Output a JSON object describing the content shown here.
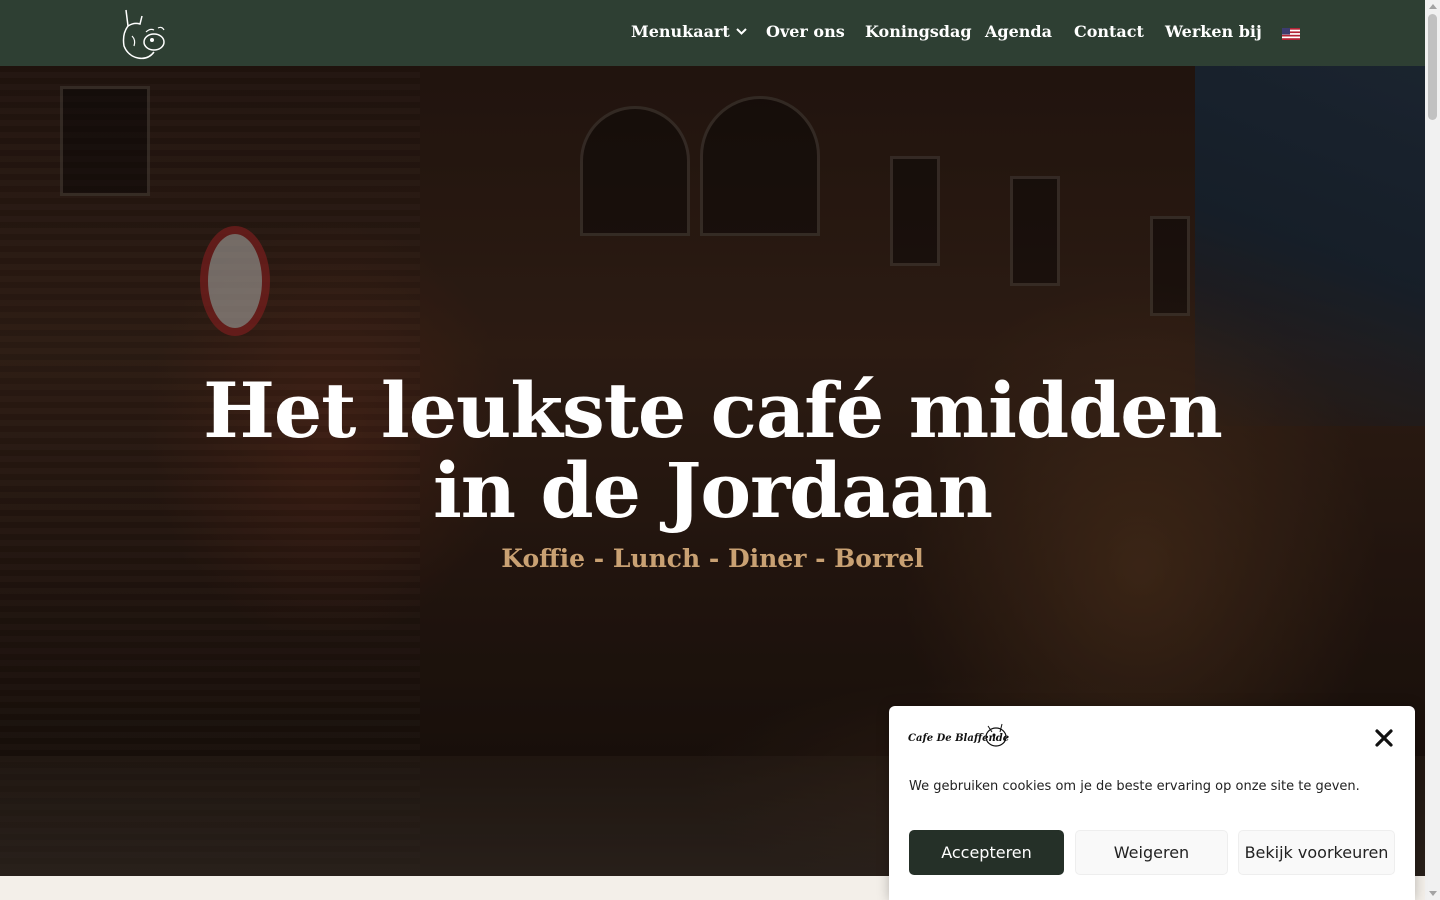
{
  "header": {
    "background": "#2e3f33",
    "nav": [
      {
        "label": "Menukaart",
        "has_dropdown": true
      },
      {
        "label": "Over ons"
      },
      {
        "label": "Koningsdag"
      },
      {
        "label": "Agenda"
      },
      {
        "label": "Contact"
      },
      {
        "label": "Werken bij"
      }
    ],
    "language_icon": "us-flag-icon"
  },
  "hero": {
    "title_line1": "Het leukste café midden",
    "title_line2": "in de Jordaan",
    "subtitle": "Koffie - Lunch - Diner - Borrel",
    "subtitle_color": "#c9a173"
  },
  "cookie_banner": {
    "logo_text": "Cafe De Blaffende Vis",
    "message": "We gebruiken cookies om je de beste ervaring op onze site te geven.",
    "accept_label": "Accepteren",
    "deny_label": "Weigeren",
    "prefs_label": "Bekijk voorkeuren",
    "accent": "#253028"
  }
}
